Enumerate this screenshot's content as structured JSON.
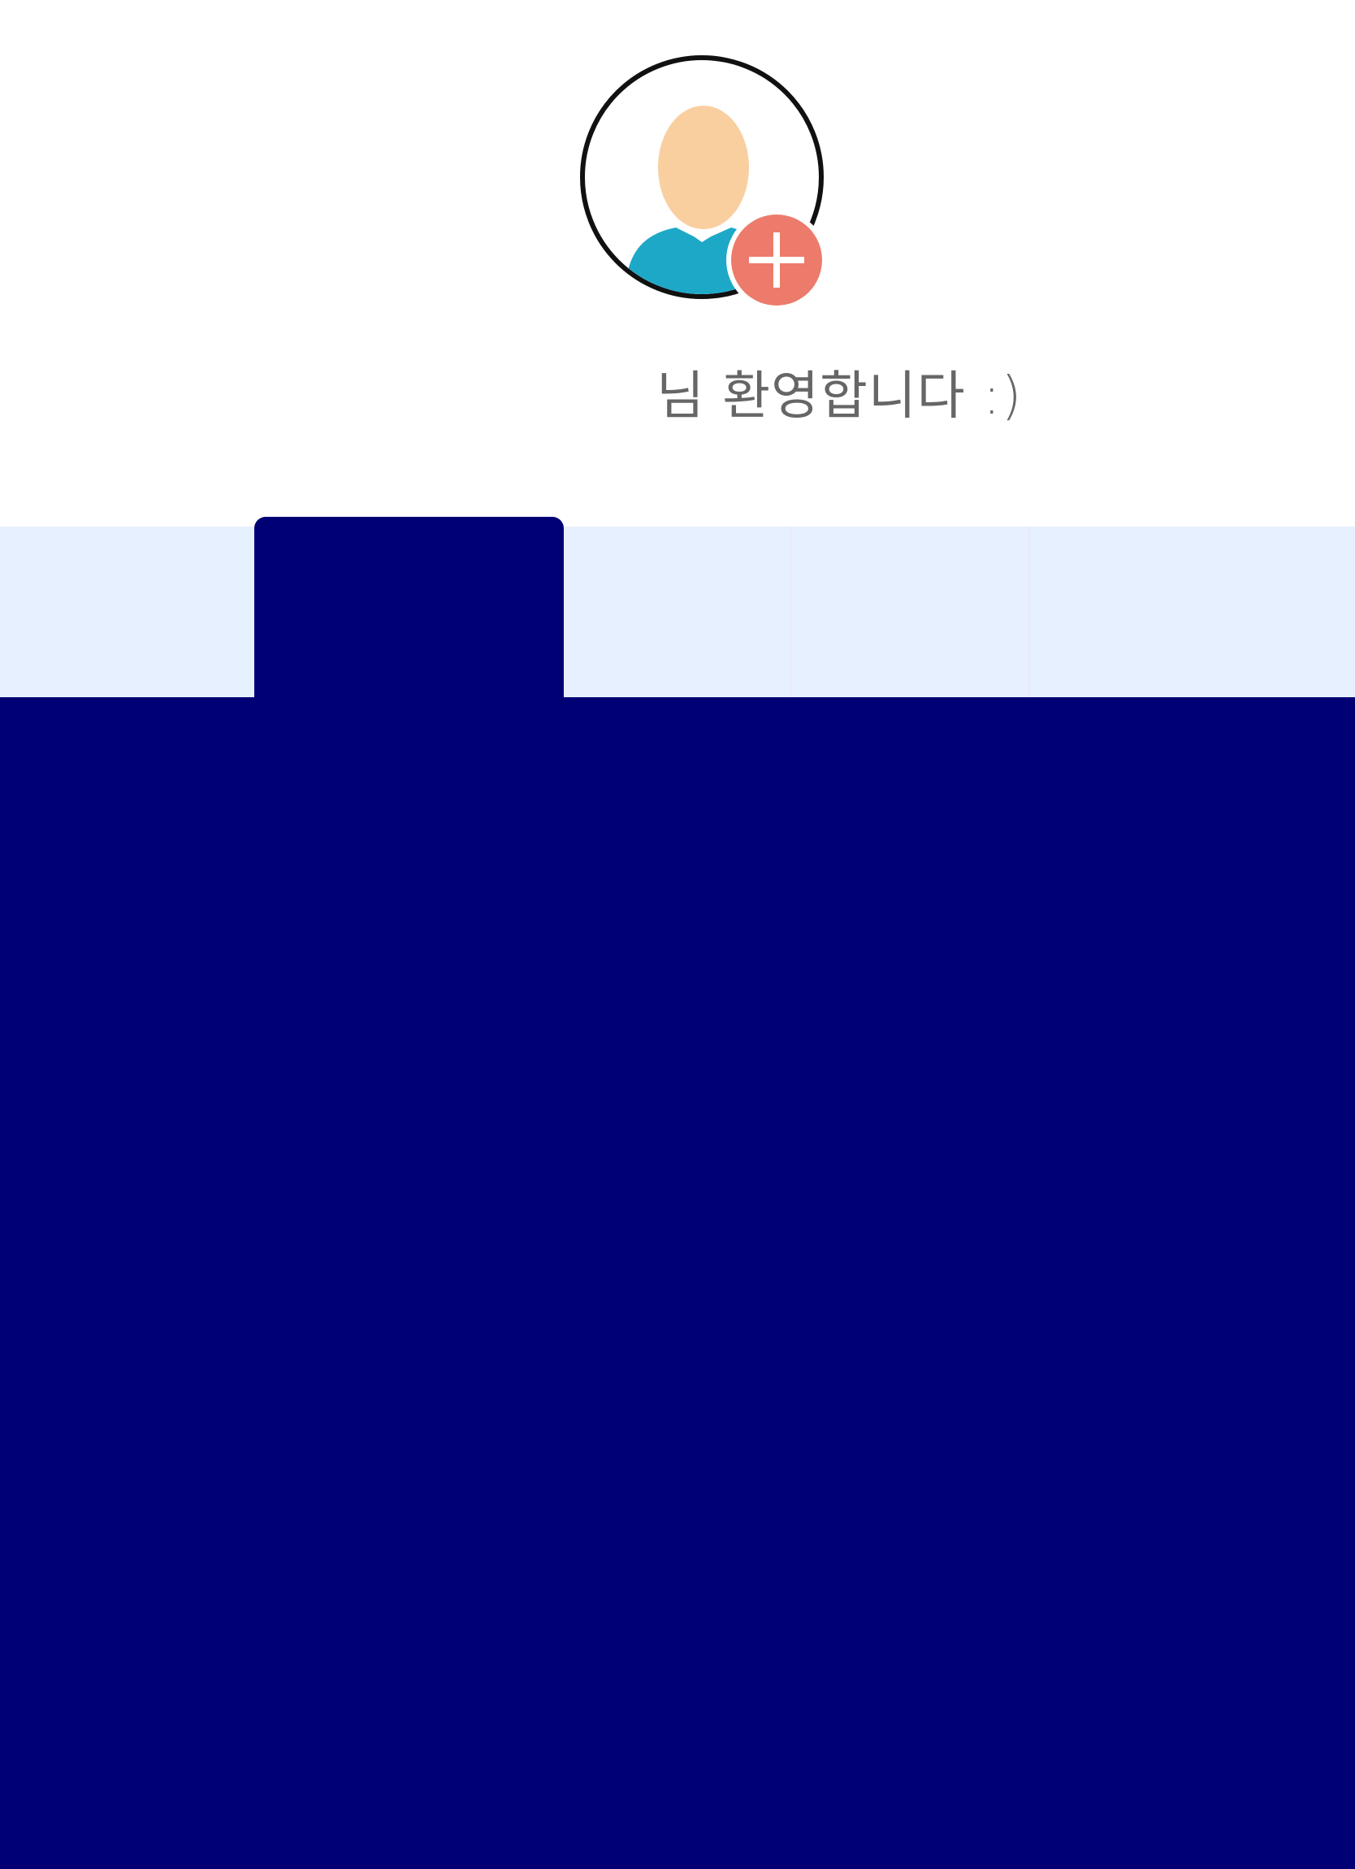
{
  "profile": {
    "avatar_icon": "user-avatar-icon",
    "add_icon": "plus-icon",
    "colors": {
      "ring": "#111111",
      "face": "#f9cfa0",
      "shirt": "#1ea8c8",
      "add_badge": "#ec7b6c"
    }
  },
  "welcome": {
    "name": "",
    "message": "님 환영합니다 :)"
  },
  "tabs": [
    {
      "label": ""
    },
    {
      "label": ""
    },
    {
      "label": ""
    },
    {
      "label": ""
    },
    {
      "label": ""
    }
  ],
  "theme": {
    "tabbar_bg": "#e6f0ff",
    "active_tab_bg": "#000075",
    "content_bg": "#000075"
  }
}
